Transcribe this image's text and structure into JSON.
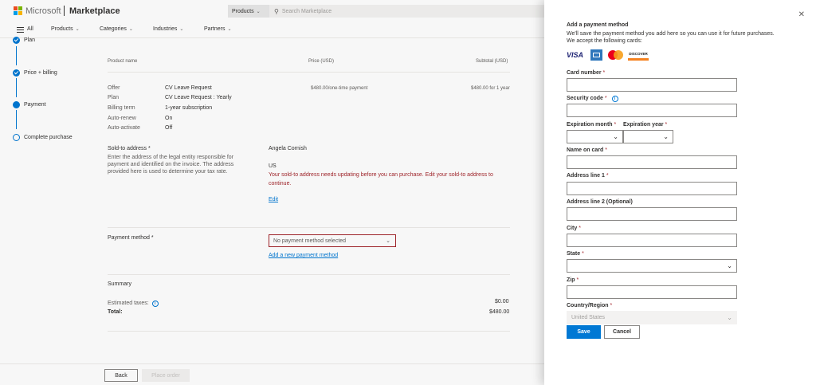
{
  "header": {
    "brand": "Microsoft",
    "section": "Marketplace",
    "search": {
      "category": "Products",
      "placeholder": "Search Marketplace"
    },
    "colors": {
      "logo_red": "#f25022",
      "logo_green": "#7fba00",
      "logo_blue": "#00a4ef",
      "logo_yellow": "#ffb900"
    }
  },
  "nav": {
    "all": "All",
    "items": [
      {
        "label": "Products"
      },
      {
        "label": "Categories"
      },
      {
        "label": "Industries"
      },
      {
        "label": "Partners"
      }
    ]
  },
  "stepper": {
    "steps": [
      {
        "label": "Plan",
        "state": "done"
      },
      {
        "label": "Price + billing",
        "state": "done"
      },
      {
        "label": "Payment",
        "state": "current"
      },
      {
        "label": "Complete purchase",
        "state": "todo"
      }
    ]
  },
  "order": {
    "columns": {
      "product": "Product name",
      "price": "Price (USD)",
      "subtotal": "Subtotal (USD)"
    },
    "details": [
      {
        "key": "Offer",
        "value": "CV Leave Request"
      },
      {
        "key": "Plan",
        "value": "CV Leave Request : Yearly"
      },
      {
        "key": "Billing term",
        "value": "1-year subscription"
      },
      {
        "key": "Auto-renew",
        "value": "On"
      },
      {
        "key": "Auto-activate",
        "value": "Off"
      }
    ],
    "price": "$480.00/one-time payment",
    "subtotal": "$480.00 for 1 year",
    "sold_to": {
      "label": "Sold-to address",
      "required_mark": "*",
      "description": "Enter the address of the legal entity responsible for payment and identified on the invoice. The address provided here is used to determine your tax rate.",
      "name": "Angela Cornish",
      "country": "US",
      "error": "Your sold-to address needs updating before you can purchase. Edit your sold-to address to continue.",
      "edit_link": "Edit"
    },
    "payment_method": {
      "label": "Payment method",
      "required_mark": "*",
      "selected": "No payment method selected",
      "add_link": "Add a new payment method"
    },
    "summary": {
      "title": "Summary",
      "taxes_label": "Estimated taxes:",
      "taxes_value": "$0.00",
      "total_label": "Total:",
      "total_value": "$480.00"
    }
  },
  "footer": {
    "back": "Back",
    "place_order": "Place order"
  },
  "panel": {
    "title": "Add a payment method",
    "desc1": "We'll save the payment method you add here so you can use it for future purchases.",
    "desc2": "We accept the following cards:",
    "cards": {
      "visa": "VISA",
      "discover": "DISCOVER"
    },
    "fields": {
      "card_number": "Card number",
      "security_code": "Security code",
      "exp_month": "Expiration month",
      "exp_year": "Expiration year",
      "name_on_card": "Name on card",
      "address1": "Address line 1",
      "address2": "Address line 2 (Optional)",
      "city": "City",
      "state": "State",
      "zip": "Zip",
      "country": "Country/Region",
      "country_value": "United States"
    },
    "required_mark": "*",
    "save": "Save",
    "cancel": "Cancel"
  }
}
